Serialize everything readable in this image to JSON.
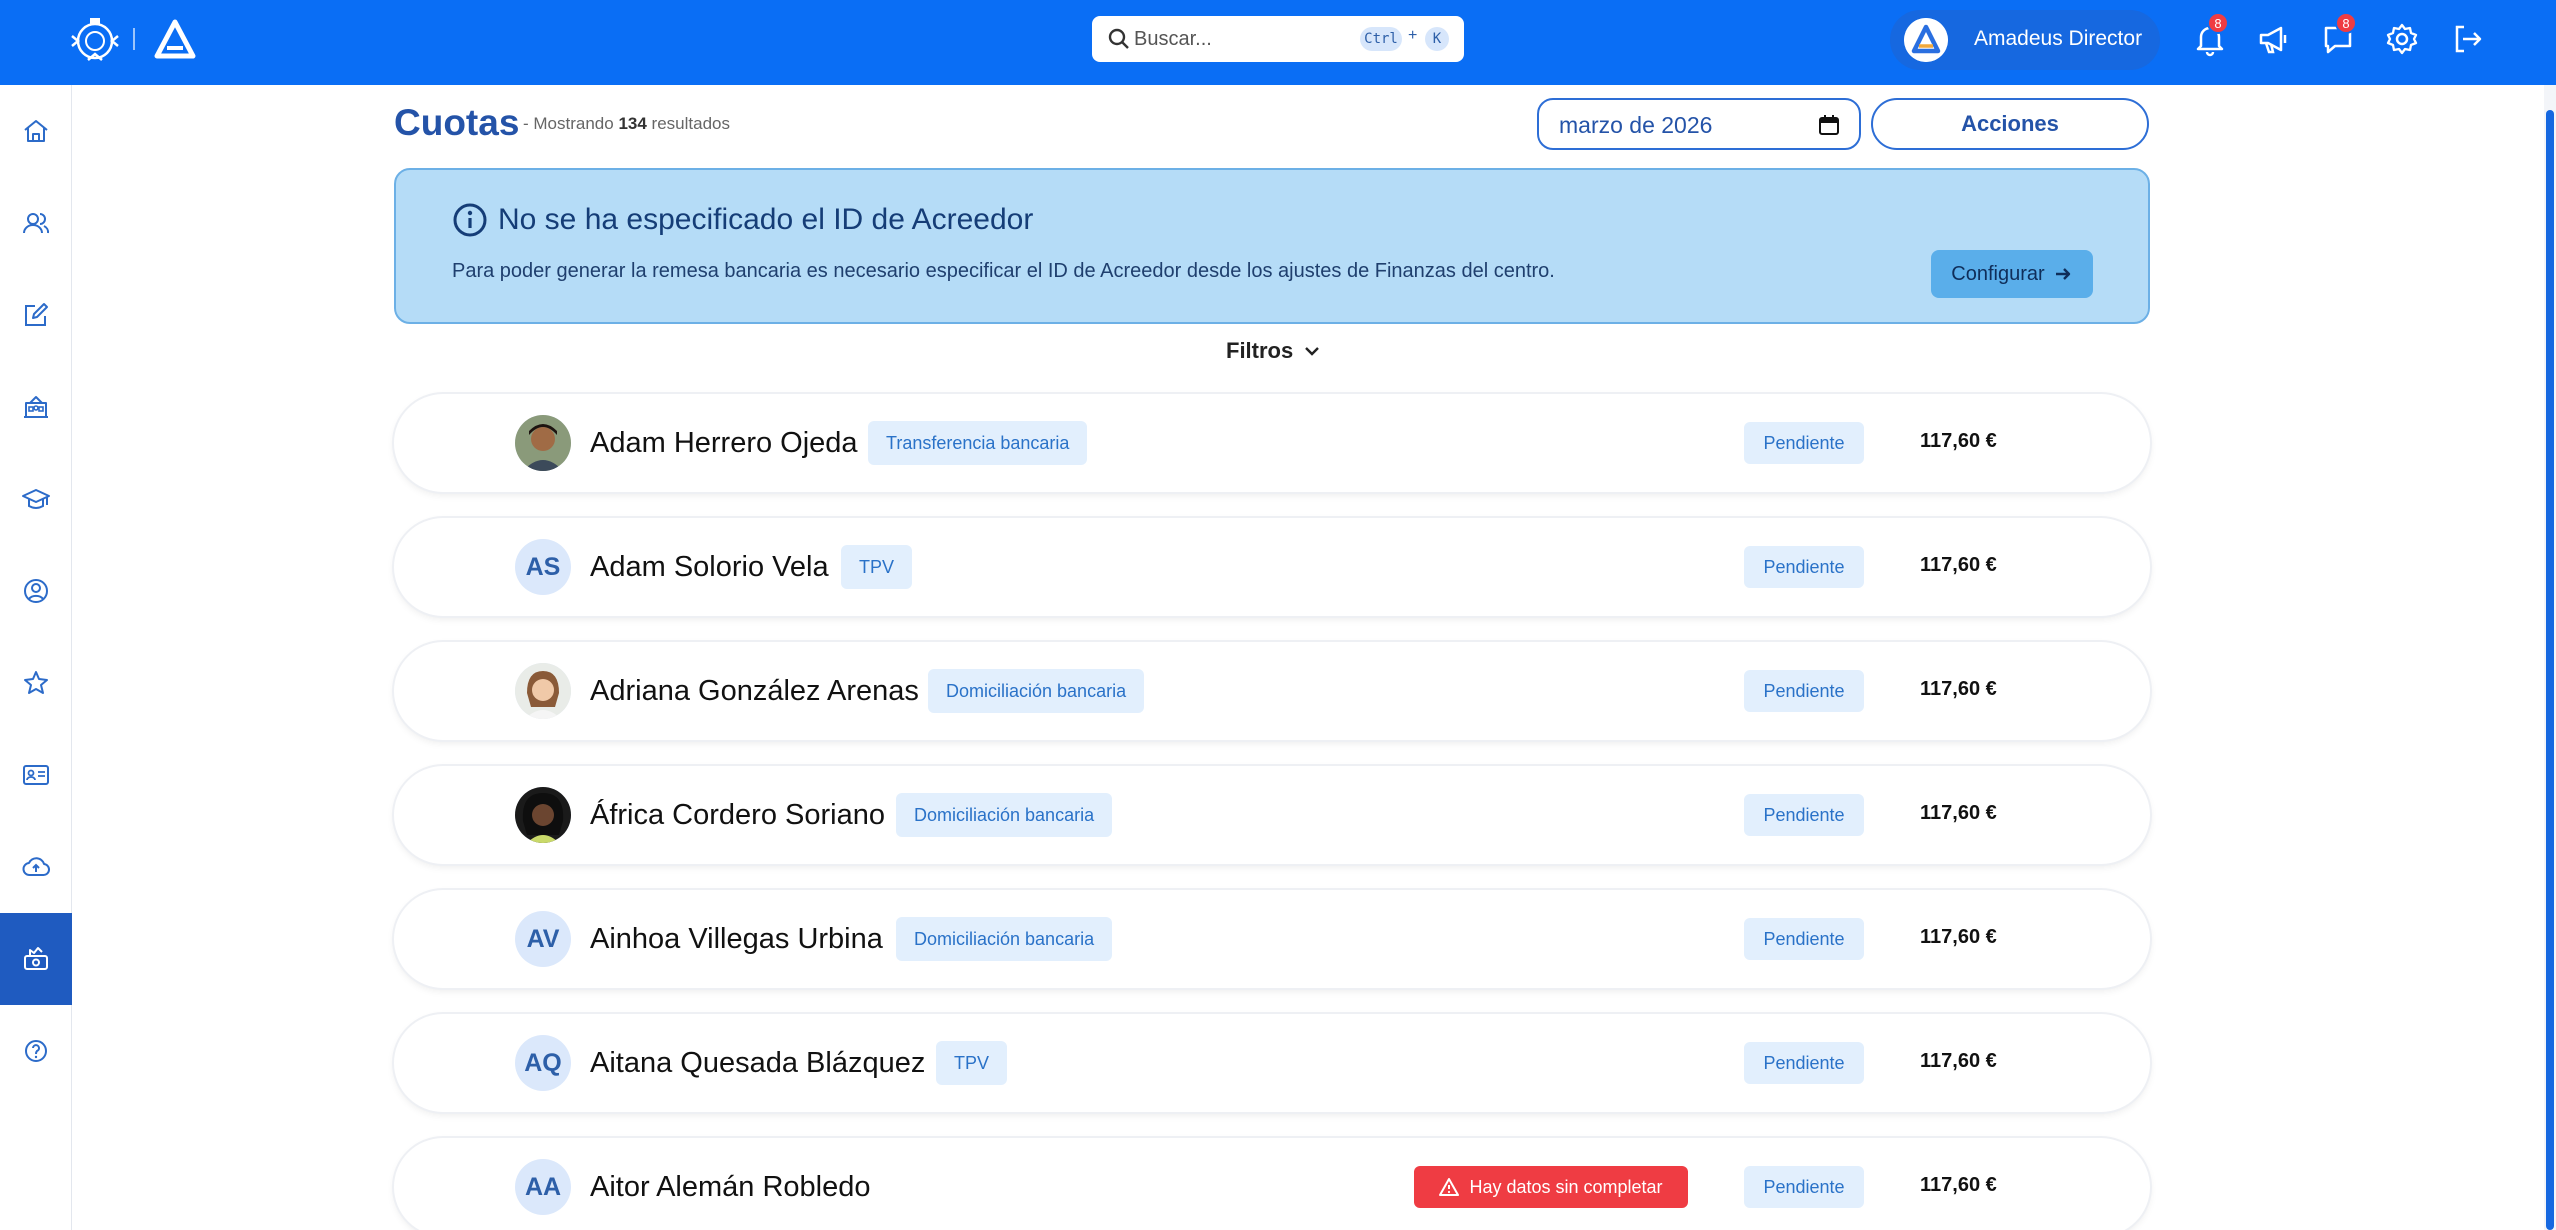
{
  "header": {
    "search_placeholder": "Buscar...",
    "shortcut_ctrl": "Ctrl",
    "shortcut_plus": "+",
    "shortcut_key": "K",
    "user_name": "Amadeus Director",
    "notifications_count": "8",
    "messages_count": "8"
  },
  "page": {
    "title": "Cuotas",
    "result_prefix": "- Mostrando",
    "result_count": "134",
    "result_suffix": "resultados",
    "month_value": "marzo de 2026",
    "actions_label": "Acciones"
  },
  "alert": {
    "title": "No se ha especificado el ID de Acreedor",
    "body": "Para poder generar la remesa bancaria es necesario especificar el ID de Acreedor desde los ajustes de Finanzas del centro.",
    "button_label": "Configurar"
  },
  "filters_label": "Filtros",
  "fees": [
    {
      "name": "Adam Herrero Ojeda",
      "initials": "",
      "method": "Transferencia bancaria",
      "status": "Pendiente",
      "amount": "117,60 €",
      "warning": ""
    },
    {
      "name": "Adam Solorio Vela",
      "initials": "AS",
      "method": "TPV",
      "status": "Pendiente",
      "amount": "117,60 €",
      "warning": ""
    },
    {
      "name": "Adriana González Arenas",
      "initials": "",
      "method": "Domiciliación bancaria",
      "status": "Pendiente",
      "amount": "117,60 €",
      "warning": ""
    },
    {
      "name": "África Cordero Soriano",
      "initials": "",
      "method": "Domiciliación bancaria",
      "status": "Pendiente",
      "amount": "117,60 €",
      "warning": ""
    },
    {
      "name": "Ainhoa Villegas Urbina",
      "initials": "AV",
      "method": "Domiciliación bancaria",
      "status": "Pendiente",
      "amount": "117,60 €",
      "warning": ""
    },
    {
      "name": "Aitana Quesada Blázquez",
      "initials": "AQ",
      "method": "TPV",
      "status": "Pendiente",
      "amount": "117,60 €",
      "warning": ""
    },
    {
      "name": "Aitor Alemán Robledo",
      "initials": "AA",
      "method": "",
      "status": "Pendiente",
      "amount": "117,60 €",
      "warning": "Hay datos sin completar"
    }
  ],
  "colors": {
    "topbar": "#0a6ef5",
    "sidebar_active": "#1f5bc0",
    "alert_bg": "#b5dcf7",
    "warning": "#ef3c43"
  }
}
